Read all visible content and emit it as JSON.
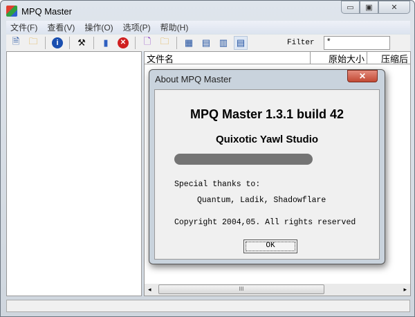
{
  "window": {
    "title": "MPQ Master",
    "minimize": "▭",
    "maximize": "▣",
    "close": "✕"
  },
  "menu": [
    "文件(F)",
    "查看(V)",
    "操作(O)",
    "选项(P)",
    "帮助(H)"
  ],
  "toolbar": {
    "filter_label": "Filter",
    "filter_value": "*"
  },
  "columns": [
    "文件名",
    "原始大小",
    "压缩后"
  ],
  "about": {
    "title": "About MPQ Master",
    "close": "✕",
    "version": "MPQ Master 1.3.1 build 42",
    "studio": "Quixotic Yawl Studio",
    "thanks_label": "Special thanks to:",
    "thanks_names": "Quantum, Ladik, Shadowflare",
    "copyright": "Copyright 2004,05. All rights reserved",
    "ok": "OK"
  },
  "scroll": {
    "grip": "III",
    "left": "◂",
    "right": "▸"
  }
}
